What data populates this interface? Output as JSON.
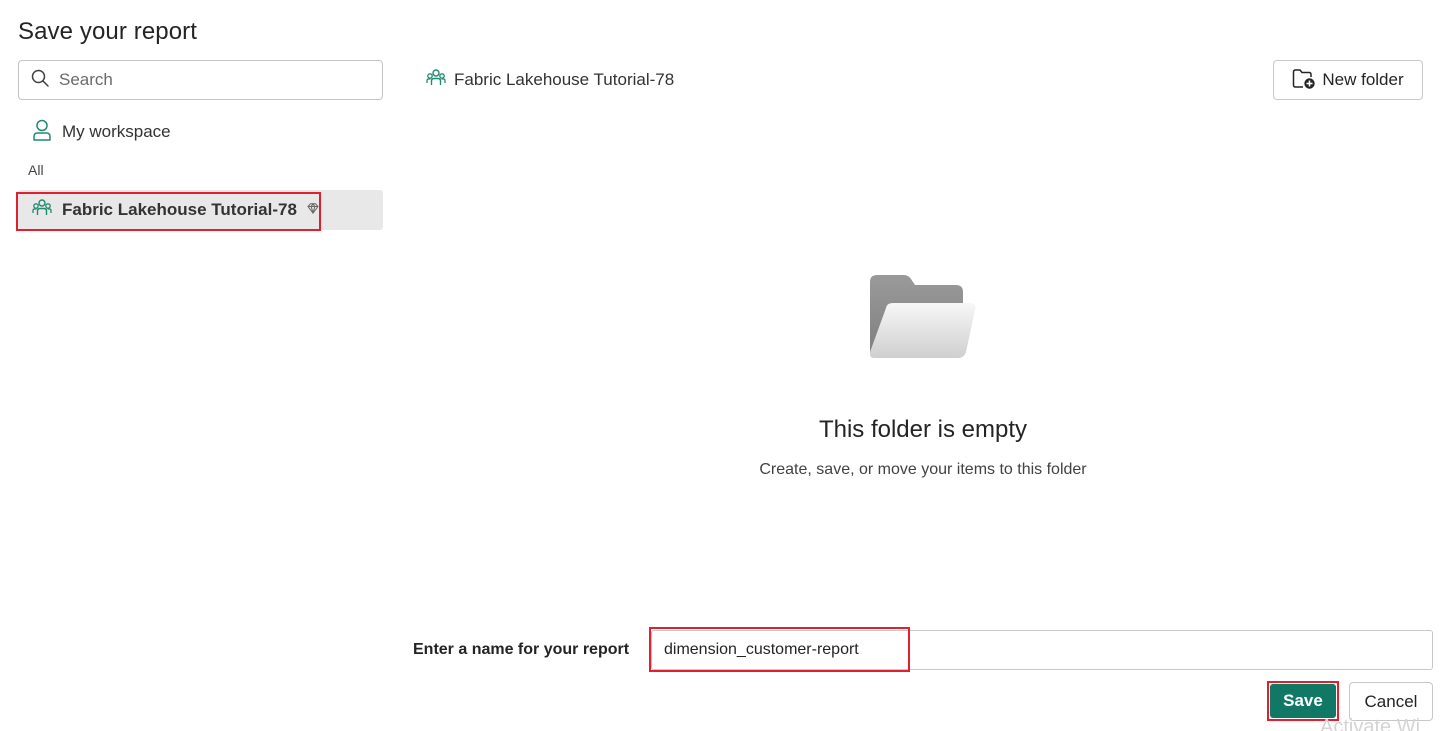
{
  "dialog": {
    "title": "Save your report"
  },
  "search": {
    "placeholder": "Search",
    "value": ""
  },
  "nav": {
    "my_workspace_label": "My workspace",
    "section_label": "All",
    "selected_workspace_label": "Fabric Lakehouse Tutorial-78"
  },
  "breadcrumb": {
    "label": "Fabric Lakehouse Tutorial-78"
  },
  "toolbar": {
    "new_folder_label": "New folder"
  },
  "empty_state": {
    "title": "This folder is empty",
    "subtitle": "Create, save, or move your items to this folder"
  },
  "form": {
    "name_label": "Enter a name for your report",
    "name_value": "dimension_customer-report"
  },
  "actions": {
    "save_label": "Save",
    "cancel_label": "Cancel"
  },
  "watermark": {
    "text": "Activate Wi"
  },
  "colors": {
    "accent": "#117865",
    "workspace_icon": "#1f8a70",
    "highlight": "#e0202e",
    "selected_bg": "#e8e8e8"
  },
  "icons": {
    "search": "search-icon",
    "person": "person-icon",
    "workspace": "workspace-people-icon",
    "premium": "diamond-icon",
    "folder_add": "folder-add-icon",
    "empty_folder": "empty-folder-illustration"
  }
}
